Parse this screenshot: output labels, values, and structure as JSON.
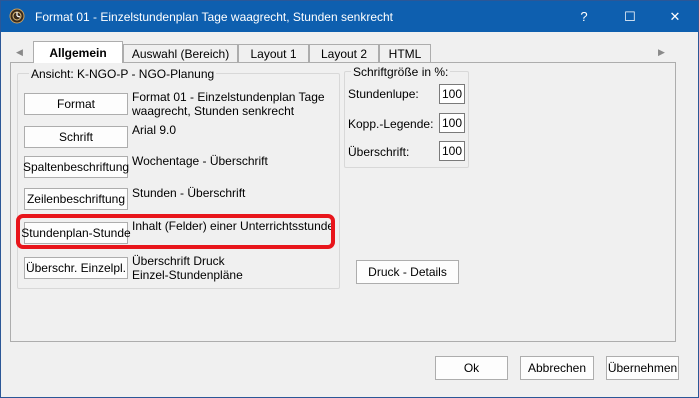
{
  "window": {
    "title": "Format 01 - Einzelstundenplan Tage waagrecht, Stunden senkrecht",
    "help_label": "?",
    "maximize_label": "☐",
    "close_label": "✕"
  },
  "tabs": [
    {
      "label": "Allgemein",
      "active": true
    },
    {
      "label": "Auswahl (Bereich)",
      "active": false
    },
    {
      "label": "Layout 1",
      "active": false
    },
    {
      "label": "Layout 2",
      "active": false
    },
    {
      "label": "HTML",
      "active": false
    }
  ],
  "tab_scroll": {
    "left": "◀",
    "right": "▶"
  },
  "ansicht": {
    "label": "Ansicht: K-NGO-P - NGO-Planung",
    "rows": [
      {
        "button": "Format",
        "desc_line1": "Format 01 - Einzelstundenplan Tage",
        "desc_line2": "waagrecht, Stunden senkrecht"
      },
      {
        "button": "Schrift",
        "desc_line1": "Arial 9.0",
        "desc_line2": ""
      },
      {
        "button": "Spaltenbeschriftung",
        "desc_line1": "Wochentage - Überschrift",
        "desc_line2": ""
      },
      {
        "button": "Zeilenbeschriftung",
        "desc_line1": "Stunden - Überschrift",
        "desc_line2": ""
      },
      {
        "button": "Stundenplan-Stunde",
        "desc_line1": "Inhalt (Felder) einer Unterrichtsstunde",
        "desc_line2": ""
      },
      {
        "button": "Überschr. Einzelpl.",
        "desc_line1": "Überschrift Druck",
        "desc_line2": "Einzel-Stundenpläne"
      }
    ]
  },
  "schrift": {
    "label": "Schriftgröße in %:",
    "fields": [
      {
        "label": "Stundenlupe:",
        "value": "100"
      },
      {
        "label": "Kopp.-Legende:",
        "value": "100"
      },
      {
        "label": "Überschrift:",
        "value": "100"
      }
    ]
  },
  "druck_details_label": "Druck - Details",
  "footer": {
    "ok": "Ok",
    "cancel": "Abbrechen",
    "apply": "Übernehmen"
  },
  "colors": {
    "titlebar": "#0e5faf",
    "highlight": "#e8151b"
  }
}
